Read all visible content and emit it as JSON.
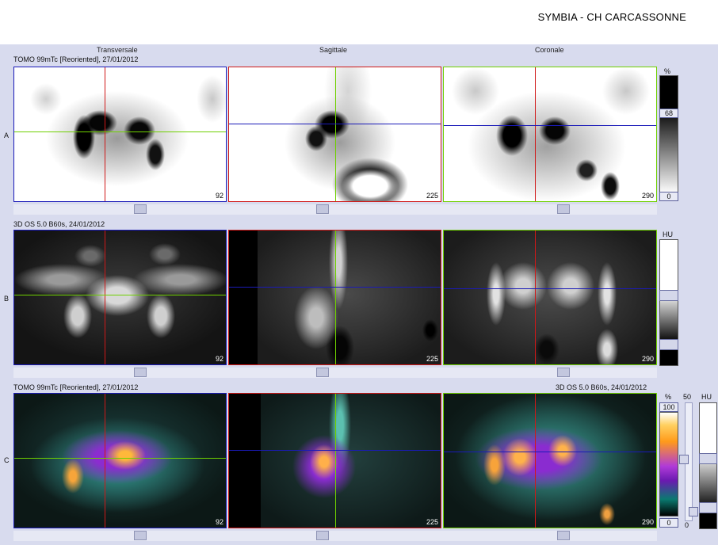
{
  "header": {
    "title": "SYMBIA - CH CARCASSONNE"
  },
  "columns": [
    "Transversale",
    "Sagittale",
    "Coronale"
  ],
  "rows": [
    {
      "letter": "A",
      "caption_left": "TOMO 99mTc [Reoriented], 27/01/2012",
      "caption_right": ""
    },
    {
      "letter": "B",
      "caption_left": "3D  OS  5.0  B60s, 24/01/2012",
      "caption_right": ""
    },
    {
      "letter": "C",
      "caption_left": "TOMO 99mTc [Reoriented], 27/01/2012",
      "caption_right": "3D  OS  5.0  B60s, 24/01/2012"
    }
  ],
  "slices": {
    "transversal": "92",
    "sagittal": "225",
    "coronal": "290"
  },
  "scales": {
    "a": {
      "unit": "%",
      "value": "68",
      "min": "0"
    },
    "b": {
      "unit": "HU"
    },
    "c_left": {
      "unit": "%",
      "max": "100",
      "min": "0"
    },
    "c_mid": {
      "label": "50",
      "min": "0"
    },
    "c_right": {
      "unit": "HU"
    }
  },
  "colors": {
    "crosshair_red": "#d01818",
    "crosshair_green": "#6fd000",
    "crosshair_blue": "#1a1ab8",
    "frame_transversal": "#1a1ab8",
    "frame_sagittal": "#d01818",
    "frame_coronal": "#6fd000"
  }
}
